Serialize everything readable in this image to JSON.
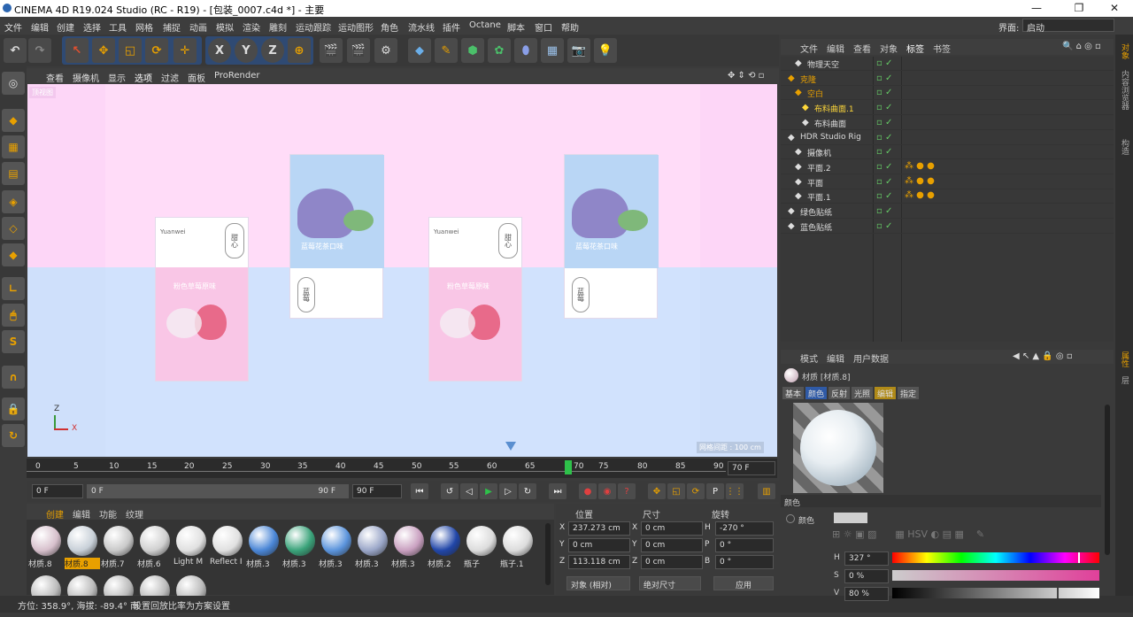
{
  "window": {
    "title": "CINEMA 4D R19.024 Studio (RC - R19) - [包装_0007.c4d *] - 主要",
    "interface_label": "界面:",
    "interface_value": "启动"
  },
  "menu": [
    "文件",
    "编辑",
    "创建",
    "选择",
    "工具",
    "网格",
    "捕捉",
    "动画",
    "模拟",
    "渲染",
    "雕刻",
    "运动跟踪",
    "运动图形",
    "角色",
    "流水线",
    "插件",
    "Octane",
    "脚本",
    "窗口",
    "帮助"
  ],
  "toolbar": {
    "x": "X",
    "y": "Y",
    "z": "Z"
  },
  "lefttools": {
    "s_label": "S"
  },
  "viewport": {
    "menu": [
      "查看",
      "摄像机",
      "显示",
      "选项",
      "过滤",
      "面板",
      "ProRender"
    ],
    "label_tl": "顶视图",
    "grid_label": "网格间距 : 100 cm",
    "axis_z": "Z",
    "axis_x": "X",
    "packages": [
      {
        "brand": "Yuanwei",
        "seal": "甜心",
        "bottom_text": "粉色草莓原味"
      },
      {
        "brand": "Yuanwei",
        "seal": "甜心",
        "bottom_text": "粉色草莓原味"
      },
      {
        "top_text": "蓝莓花茶口味",
        "seal": "蓝莓"
      },
      {
        "top_text": "蓝莓花茶口味",
        "seal": "蓝莓"
      }
    ]
  },
  "timeline": {
    "ticks": [
      "0",
      "5",
      "10",
      "15",
      "20",
      "25",
      "30",
      "35",
      "40",
      "45",
      "50",
      "55",
      "60",
      "65",
      "70",
      "75",
      "80",
      "85",
      "90"
    ],
    "current": "70",
    "frame_field": "70 F"
  },
  "ctrl": {
    "start": "0 F",
    "range_start": "0 F",
    "range_end": "90 F",
    "end": "90 F"
  },
  "materials": {
    "menu": [
      "创建",
      "编辑",
      "功能",
      "纹理"
    ],
    "items": [
      {
        "label": "材质.8",
        "color": "#d7c0cc"
      },
      {
        "label": "材质.8",
        "color": "#c8d0d8",
        "selected": true
      },
      {
        "label": "材质.7",
        "color": "#c9c9c9"
      },
      {
        "label": "材质.6",
        "color": "#d0d0d0"
      },
      {
        "label": "Light M",
        "color": "#e0e0e0"
      },
      {
        "label": "Reflect I",
        "color": "#e0e0e0"
      },
      {
        "label": "材质.3",
        "color": "#4a86d6"
      },
      {
        "label": "材质.3",
        "color": "#3aa37a"
      },
      {
        "label": "材质.3",
        "color": "#5b94dc"
      },
      {
        "label": "材质.3",
        "color": "#9aa6c8"
      },
      {
        "label": "材质.3",
        "color": "#c9a0c0"
      },
      {
        "label": "材质.2",
        "color": "#2146a8"
      },
      {
        "label": "瓶子",
        "color": "#dcdcdc"
      },
      {
        "label": "瓶子.1",
        "color": "#dcdcdc"
      }
    ]
  },
  "coords": {
    "pos": "位置",
    "size": "尺寸",
    "rot": "旋转",
    "rows": [
      {
        "axis": "X",
        "pos": "237.273 cm",
        "saxis": "X",
        "size": "0 cm",
        "raxis": "H",
        "rot": "-270 °"
      },
      {
        "axis": "Y",
        "pos": "0 cm",
        "saxis": "Y",
        "size": "0 cm",
        "raxis": "P",
        "rot": "0 °"
      },
      {
        "axis": "Z",
        "pos": "113.118 cm",
        "saxis": "Z",
        "size": "0 cm",
        "raxis": "B",
        "rot": "0 °"
      }
    ],
    "mode": "对象 (相对)",
    "size_mode": "绝对尺寸",
    "apply": "应用"
  },
  "status": {
    "coords": "方位: 358.9°, 海拔: -89.4° 南",
    "msg": "设置回放比率为方案设置"
  },
  "objects": {
    "menu": [
      "文件",
      "编辑",
      "查看",
      "对象",
      "标签",
      "书签"
    ],
    "rows": [
      {
        "name": "物理天空",
        "color": "#ddd"
      },
      {
        "name": "克隆",
        "color": "#e8a000"
      },
      {
        "name": "空白",
        "color": "#e8a000"
      },
      {
        "name": "布料曲面.1",
        "color": "#ffd83a"
      },
      {
        "name": "布料曲面",
        "color": "#ddd"
      },
      {
        "name": "HDR Studio Rig",
        "color": "#ddd"
      },
      {
        "name": "摄像机",
        "color": "#ddd"
      },
      {
        "name": "平面.2",
        "color": "#ddd"
      },
      {
        "name": "平面",
        "color": "#ddd"
      },
      {
        "name": "平面.1",
        "color": "#ddd"
      },
      {
        "name": "绿色贴纸",
        "color": "#ddd"
      },
      {
        "name": "蓝色贴纸",
        "color": "#ddd"
      }
    ]
  },
  "attributes": {
    "menu": [
      "模式",
      "编辑",
      "用户数据"
    ],
    "title": "材质 [材质.8]",
    "tabs": [
      "基本",
      "颜色",
      "反射",
      "光照",
      "编辑",
      "指定"
    ],
    "section": "颜色",
    "color_label": "颜色",
    "h": "327 °",
    "s": "0 %",
    "v": "80 %"
  },
  "sidetabs": [
    "对象",
    "内容浏览器",
    "构造"
  ],
  "attr_sidetabs": [
    "属性",
    "层"
  ]
}
